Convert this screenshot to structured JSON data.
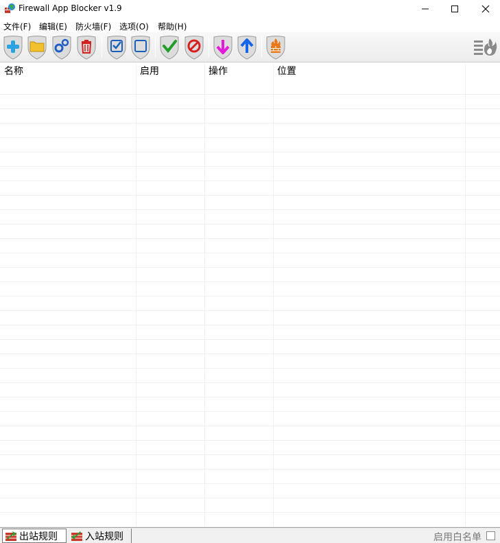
{
  "window": {
    "title": "Firewall App Blocker v1.9"
  },
  "menu": {
    "items": [
      {
        "label": "文件(F)"
      },
      {
        "label": "编辑(E)"
      },
      {
        "label": "防火墙(F)"
      },
      {
        "label": "选项(O)"
      },
      {
        "label": "帮助(H)"
      }
    ]
  },
  "toolbar": {
    "buttons": [
      {
        "icon": "add-icon"
      },
      {
        "icon": "folder-icon"
      },
      {
        "icon": "gears-icon"
      },
      {
        "icon": "trash-icon"
      },
      {
        "icon": "checkbox-checked-icon"
      },
      {
        "icon": "checkbox-empty-icon"
      },
      {
        "icon": "check-icon"
      },
      {
        "icon": "block-icon"
      },
      {
        "icon": "arrow-down-icon"
      },
      {
        "icon": "arrow-up-icon"
      },
      {
        "icon": "firewall-icon"
      },
      {
        "icon": "firewall-menu-icon"
      }
    ],
    "colors": {
      "shield": "#d9d9d9",
      "add": "#2aa3e0",
      "folder": "#f2c12e",
      "gears": "#1f5fc4",
      "trash": "#d21f1f",
      "checkbox": "#1b5fb8",
      "check": "#1e9e28",
      "block": "#d62020",
      "down": "#e41bd9",
      "up": "#1565e8",
      "firewall": "#e8791b"
    }
  },
  "list": {
    "columns": [
      {
        "label": "名称"
      },
      {
        "label": "启用"
      },
      {
        "label": "操作"
      },
      {
        "label": "位置"
      }
    ],
    "rows": []
  },
  "statusbar": {
    "tabs": [
      {
        "label": "出站规则",
        "active": true
      },
      {
        "label": "入站规则",
        "active": false
      }
    ],
    "whitelist_label": "启用白名单",
    "whitelist_checked": false
  }
}
